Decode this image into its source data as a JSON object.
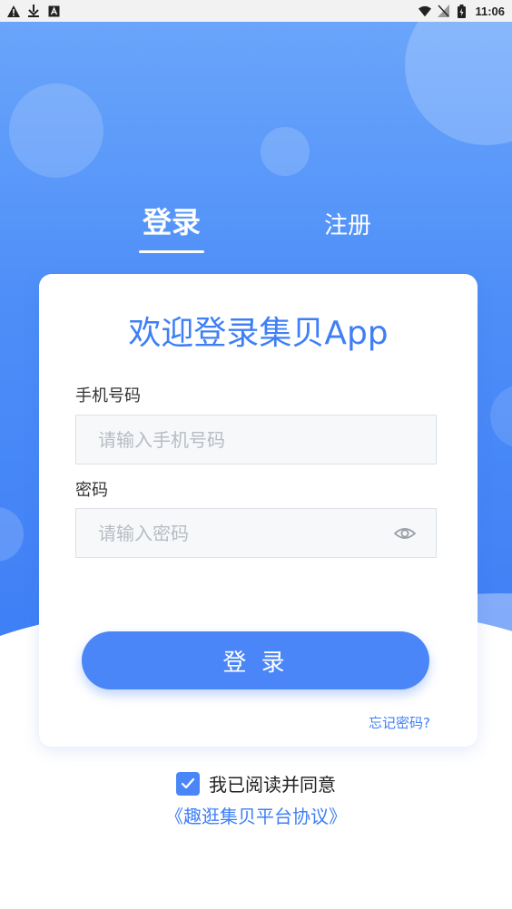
{
  "status_bar": {
    "left_icons": [
      "warning-icon",
      "download-icon",
      "a-box-icon"
    ],
    "right_icons": [
      "wifi-icon",
      "no-sim-icon",
      "battery-charging-icon"
    ],
    "time": "11:06"
  },
  "tabs": [
    {
      "label": "登录",
      "active": true
    },
    {
      "label": "注册",
      "active": false
    }
  ],
  "card": {
    "welcome": "欢迎登录集贝App",
    "phone": {
      "label": "手机号码",
      "placeholder": "请输入手机号码",
      "value": ""
    },
    "password": {
      "label": "密码",
      "placeholder": "请输入密码",
      "value": "",
      "toggle_icon": "eye-icon"
    },
    "login_button": "登 录",
    "forgot_link": "忘记密码?"
  },
  "agreement": {
    "checked": true,
    "text": "我已阅读并同意",
    "protocol_link": "《趣逛集贝平台协议》"
  },
  "colors": {
    "accent": "#4a86f7",
    "hero_top": "#6aa5fb",
    "hero_bottom": "#3f7ff6"
  }
}
